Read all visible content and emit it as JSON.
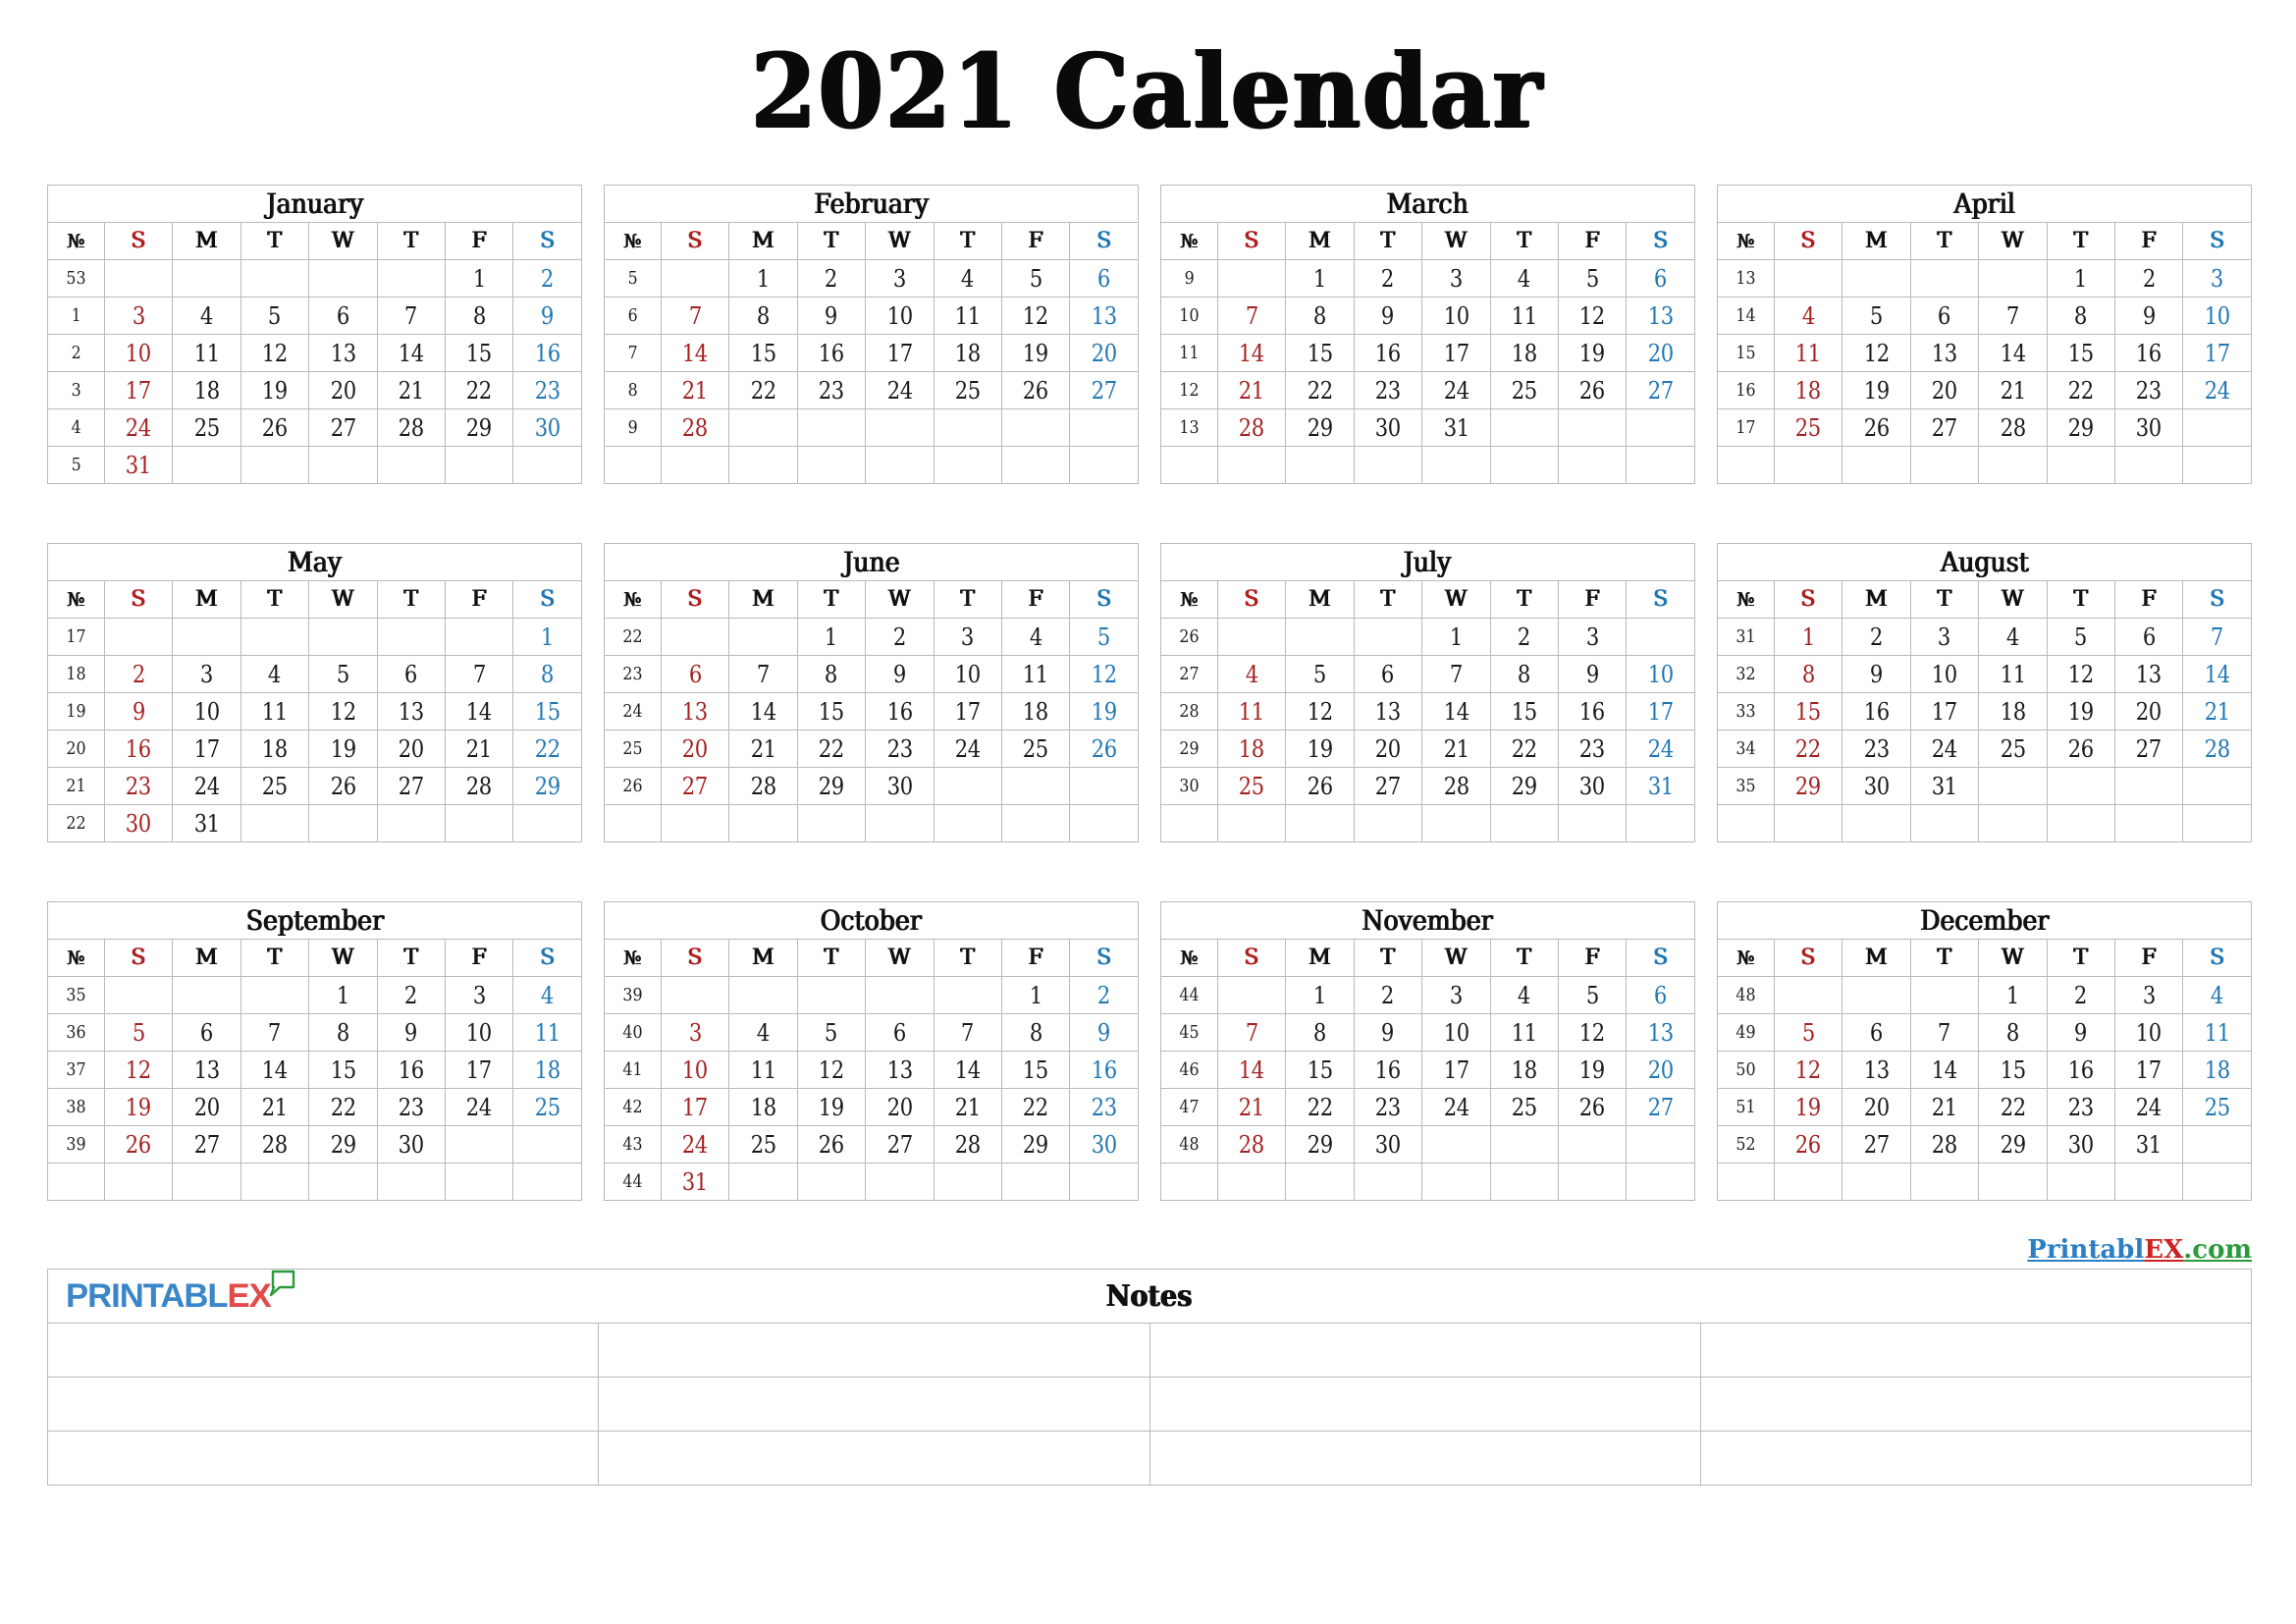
{
  "document": {
    "title": "2021 Calendar",
    "year": "2021"
  },
  "colors": {
    "sunday": "#a52121",
    "saturday": "#1f77b4",
    "weekday": "#1a1a1a",
    "grid": "#b9b9b9",
    "logo_blue": "#3a86c8",
    "logo_red": "#e24b4b",
    "logo_green": "#2a9a3a"
  },
  "weekday_headers": {
    "week_number": "№",
    "days": [
      "S",
      "M",
      "T",
      "W",
      "T",
      "F",
      "S"
    ]
  },
  "months": [
    {
      "name": "January",
      "weeks": [
        {
          "no": "53",
          "days": [
            "",
            "",
            "",
            "",
            "",
            "1",
            "2"
          ]
        },
        {
          "no": "1",
          "days": [
            "3",
            "4",
            "5",
            "6",
            "7",
            "8",
            "9"
          ]
        },
        {
          "no": "2",
          "days": [
            "10",
            "11",
            "12",
            "13",
            "14",
            "15",
            "16"
          ]
        },
        {
          "no": "3",
          "days": [
            "17",
            "18",
            "19",
            "20",
            "21",
            "22",
            "23"
          ]
        },
        {
          "no": "4",
          "days": [
            "24",
            "25",
            "26",
            "27",
            "28",
            "29",
            "30"
          ]
        },
        {
          "no": "5",
          "days": [
            "31",
            "",
            "",
            "",
            "",
            "",
            ""
          ]
        }
      ]
    },
    {
      "name": "February",
      "weeks": [
        {
          "no": "5",
          "days": [
            "",
            "1",
            "2",
            "3",
            "4",
            "5",
            "6"
          ]
        },
        {
          "no": "6",
          "days": [
            "7",
            "8",
            "9",
            "10",
            "11",
            "12",
            "13"
          ]
        },
        {
          "no": "7",
          "days": [
            "14",
            "15",
            "16",
            "17",
            "18",
            "19",
            "20"
          ]
        },
        {
          "no": "8",
          "days": [
            "21",
            "22",
            "23",
            "24",
            "25",
            "26",
            "27"
          ]
        },
        {
          "no": "9",
          "days": [
            "28",
            "",
            "",
            "",
            "",
            "",
            ""
          ]
        },
        {
          "no": "",
          "days": [
            "",
            "",
            "",
            "",
            "",
            "",
            ""
          ]
        }
      ]
    },
    {
      "name": "March",
      "weeks": [
        {
          "no": "9",
          "days": [
            "",
            "1",
            "2",
            "3",
            "4",
            "5",
            "6"
          ]
        },
        {
          "no": "10",
          "days": [
            "7",
            "8",
            "9",
            "10",
            "11",
            "12",
            "13"
          ]
        },
        {
          "no": "11",
          "days": [
            "14",
            "15",
            "16",
            "17",
            "18",
            "19",
            "20"
          ]
        },
        {
          "no": "12",
          "days": [
            "21",
            "22",
            "23",
            "24",
            "25",
            "26",
            "27"
          ]
        },
        {
          "no": "13",
          "days": [
            "28",
            "29",
            "30",
            "31",
            "",
            "",
            ""
          ]
        },
        {
          "no": "",
          "days": [
            "",
            "",
            "",
            "",
            "",
            "",
            ""
          ]
        }
      ]
    },
    {
      "name": "April",
      "weeks": [
        {
          "no": "13",
          "days": [
            "",
            "",
            "",
            "",
            "1",
            "2",
            "3"
          ]
        },
        {
          "no": "14",
          "days": [
            "4",
            "5",
            "6",
            "7",
            "8",
            "9",
            "10"
          ]
        },
        {
          "no": "15",
          "days": [
            "11",
            "12",
            "13",
            "14",
            "15",
            "16",
            "17"
          ]
        },
        {
          "no": "16",
          "days": [
            "18",
            "19",
            "20",
            "21",
            "22",
            "23",
            "24"
          ]
        },
        {
          "no": "17",
          "days": [
            "25",
            "26",
            "27",
            "28",
            "29",
            "30",
            ""
          ]
        },
        {
          "no": "",
          "days": [
            "",
            "",
            "",
            "",
            "",
            "",
            ""
          ]
        }
      ]
    },
    {
      "name": "May",
      "weeks": [
        {
          "no": "17",
          "days": [
            "",
            "",
            "",
            "",
            "",
            "",
            "1"
          ]
        },
        {
          "no": "18",
          "days": [
            "2",
            "3",
            "4",
            "5",
            "6",
            "7",
            "8"
          ]
        },
        {
          "no": "19",
          "days": [
            "9",
            "10",
            "11",
            "12",
            "13",
            "14",
            "15"
          ]
        },
        {
          "no": "20",
          "days": [
            "16",
            "17",
            "18",
            "19",
            "20",
            "21",
            "22"
          ]
        },
        {
          "no": "21",
          "days": [
            "23",
            "24",
            "25",
            "26",
            "27",
            "28",
            "29"
          ]
        },
        {
          "no": "22",
          "days": [
            "30",
            "31",
            "",
            "",
            "",
            "",
            ""
          ]
        }
      ]
    },
    {
      "name": "June",
      "weeks": [
        {
          "no": "22",
          "days": [
            "",
            "",
            "1",
            "2",
            "3",
            "4",
            "5"
          ]
        },
        {
          "no": "23",
          "days": [
            "6",
            "7",
            "8",
            "9",
            "10",
            "11",
            "12"
          ]
        },
        {
          "no": "24",
          "days": [
            "13",
            "14",
            "15",
            "16",
            "17",
            "18",
            "19"
          ]
        },
        {
          "no": "25",
          "days": [
            "20",
            "21",
            "22",
            "23",
            "24",
            "25",
            "26"
          ]
        },
        {
          "no": "26",
          "days": [
            "27",
            "28",
            "29",
            "30",
            "",
            "",
            ""
          ]
        },
        {
          "no": "",
          "days": [
            "",
            "",
            "",
            "",
            "",
            "",
            ""
          ]
        }
      ]
    },
    {
      "name": "July",
      "weeks": [
        {
          "no": "26",
          "days": [
            "",
            "",
            "",
            "1",
            "2",
            "3",
            ""
          ]
        },
        {
          "no": "27",
          "days": [
            "4",
            "5",
            "6",
            "7",
            "8",
            "9",
            "10"
          ]
        },
        {
          "no": "28",
          "days": [
            "11",
            "12",
            "13",
            "14",
            "15",
            "16",
            "17"
          ]
        },
        {
          "no": "29",
          "days": [
            "18",
            "19",
            "20",
            "21",
            "22",
            "23",
            "24"
          ]
        },
        {
          "no": "30",
          "days": [
            "25",
            "26",
            "27",
            "28",
            "29",
            "30",
            "31"
          ]
        },
        {
          "no": "",
          "days": [
            "",
            "",
            "",
            "",
            "",
            "",
            ""
          ]
        }
      ]
    },
    {
      "name": "August",
      "weeks": [
        {
          "no": "31",
          "days": [
            "1",
            "2",
            "3",
            "4",
            "5",
            "6",
            "7"
          ]
        },
        {
          "no": "32",
          "days": [
            "8",
            "9",
            "10",
            "11",
            "12",
            "13",
            "14"
          ]
        },
        {
          "no": "33",
          "days": [
            "15",
            "16",
            "17",
            "18",
            "19",
            "20",
            "21"
          ]
        },
        {
          "no": "34",
          "days": [
            "22",
            "23",
            "24",
            "25",
            "26",
            "27",
            "28"
          ]
        },
        {
          "no": "35",
          "days": [
            "29",
            "30",
            "31",
            "",
            "",
            "",
            ""
          ]
        },
        {
          "no": "",
          "days": [
            "",
            "",
            "",
            "",
            "",
            "",
            ""
          ]
        }
      ]
    },
    {
      "name": "September",
      "weeks": [
        {
          "no": "35",
          "days": [
            "",
            "",
            "",
            "1",
            "2",
            "3",
            "4"
          ]
        },
        {
          "no": "36",
          "days": [
            "5",
            "6",
            "7",
            "8",
            "9",
            "10",
            "11"
          ]
        },
        {
          "no": "37",
          "days": [
            "12",
            "13",
            "14",
            "15",
            "16",
            "17",
            "18"
          ]
        },
        {
          "no": "38",
          "days": [
            "19",
            "20",
            "21",
            "22",
            "23",
            "24",
            "25"
          ]
        },
        {
          "no": "39",
          "days": [
            "26",
            "27",
            "28",
            "29",
            "30",
            "",
            ""
          ]
        },
        {
          "no": "",
          "days": [
            "",
            "",
            "",
            "",
            "",
            "",
            ""
          ]
        }
      ]
    },
    {
      "name": "October",
      "weeks": [
        {
          "no": "39",
          "days": [
            "",
            "",
            "",
            "",
            "",
            "1",
            "2"
          ]
        },
        {
          "no": "40",
          "days": [
            "3",
            "4",
            "5",
            "6",
            "7",
            "8",
            "9"
          ]
        },
        {
          "no": "41",
          "days": [
            "10",
            "11",
            "12",
            "13",
            "14",
            "15",
            "16"
          ]
        },
        {
          "no": "42",
          "days": [
            "17",
            "18",
            "19",
            "20",
            "21",
            "22",
            "23"
          ]
        },
        {
          "no": "43",
          "days": [
            "24",
            "25",
            "26",
            "27",
            "28",
            "29",
            "30"
          ]
        },
        {
          "no": "44",
          "days": [
            "31",
            "",
            "",
            "",
            "",
            "",
            ""
          ]
        }
      ]
    },
    {
      "name": "November",
      "weeks": [
        {
          "no": "44",
          "days": [
            "",
            "1",
            "2",
            "3",
            "4",
            "5",
            "6"
          ]
        },
        {
          "no": "45",
          "days": [
            "7",
            "8",
            "9",
            "10",
            "11",
            "12",
            "13"
          ]
        },
        {
          "no": "46",
          "days": [
            "14",
            "15",
            "16",
            "17",
            "18",
            "19",
            "20"
          ]
        },
        {
          "no": "47",
          "days": [
            "21",
            "22",
            "23",
            "24",
            "25",
            "26",
            "27"
          ]
        },
        {
          "no": "48",
          "days": [
            "28",
            "29",
            "30",
            "",
            "",
            "",
            ""
          ]
        },
        {
          "no": "",
          "days": [
            "",
            "",
            "",
            "",
            "",
            "",
            ""
          ]
        }
      ]
    },
    {
      "name": "December",
      "weeks": [
        {
          "no": "48",
          "days": [
            "",
            "",
            "",
            "1",
            "2",
            "3",
            "4"
          ]
        },
        {
          "no": "49",
          "days": [
            "5",
            "6",
            "7",
            "8",
            "9",
            "10",
            "11"
          ]
        },
        {
          "no": "50",
          "days": [
            "12",
            "13",
            "14",
            "15",
            "16",
            "17",
            "18"
          ]
        },
        {
          "no": "51",
          "days": [
            "19",
            "20",
            "21",
            "22",
            "23",
            "24",
            "25"
          ]
        },
        {
          "no": "52",
          "days": [
            "26",
            "27",
            "28",
            "29",
            "30",
            "31",
            ""
          ]
        },
        {
          "no": "",
          "days": [
            "",
            "",
            "",
            "",
            "",
            "",
            ""
          ]
        }
      ]
    }
  ],
  "watermark": {
    "part1": "Printabl",
    "part2": "EX",
    "part3": ".com"
  },
  "logo": {
    "part1": "PRINTABL",
    "part2": "EX",
    "icon": "speech-tag-icon"
  },
  "notes": {
    "title": "Notes",
    "row_count": 3,
    "column_count": 4
  }
}
